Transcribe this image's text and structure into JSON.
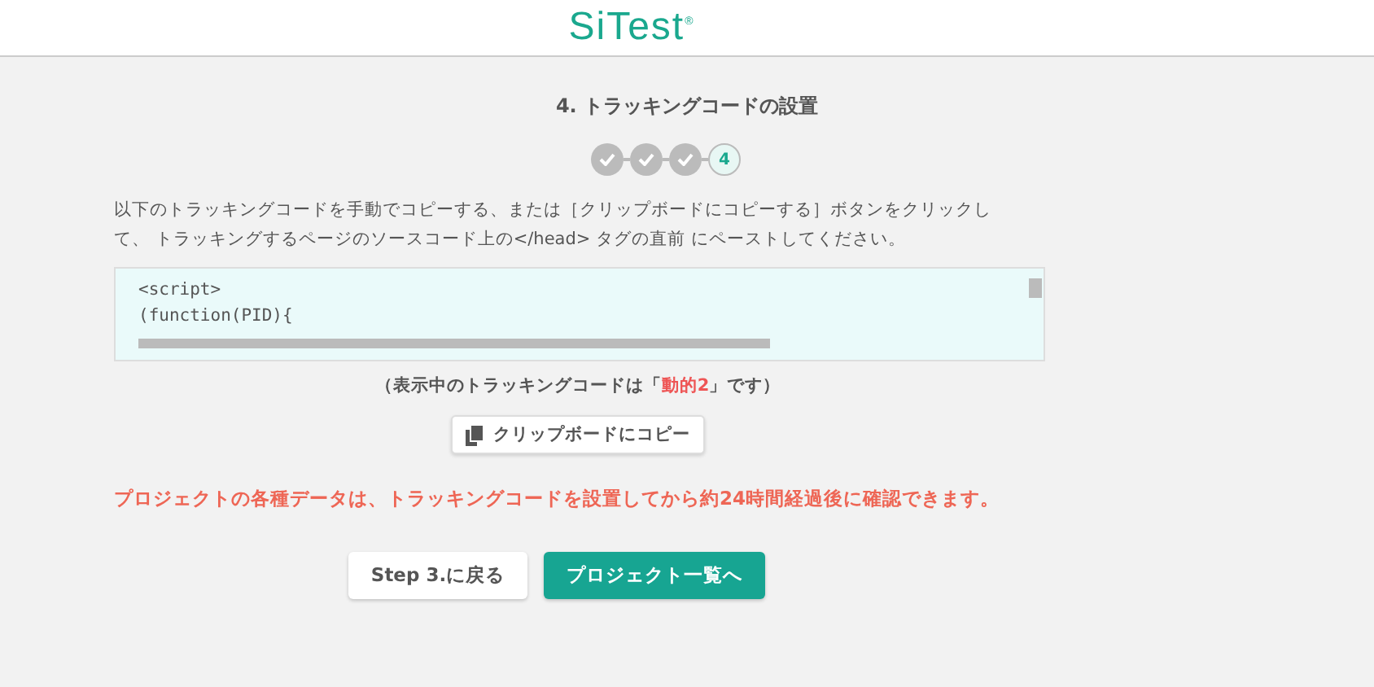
{
  "header": {
    "logo": "SiTest",
    "logo_mark": "®"
  },
  "title": "4. トラッキングコードの設置",
  "steps": [
    {
      "done": true
    },
    {
      "done": true
    },
    {
      "done": true
    },
    {
      "label": "4",
      "done": false
    }
  ],
  "instructions": "以下のトラッキングコードを手動でコピーする、または［クリップボードにコピーする］ボタンをクリックして、 トラッキングするページのソースコード上の</head> タグの直前 にペーストしてください。",
  "code_lines": [
    "<script>",
    "(function(PID){"
  ],
  "code_note": "（表示中のトラッキングコードは「*動的2*」です）",
  "copy_button": "クリップボードにコピー",
  "warning": "プロジェクトの各種データは、トラッキングコードを設置してから約24時間経過後に確認できます。",
  "buttons": [
    {
      "label": "Step 3.に戻る",
      "kind": "secondary"
    },
    {
      "label": "プロジェクト一覧へ",
      "kind": "primary"
    }
  ]
}
